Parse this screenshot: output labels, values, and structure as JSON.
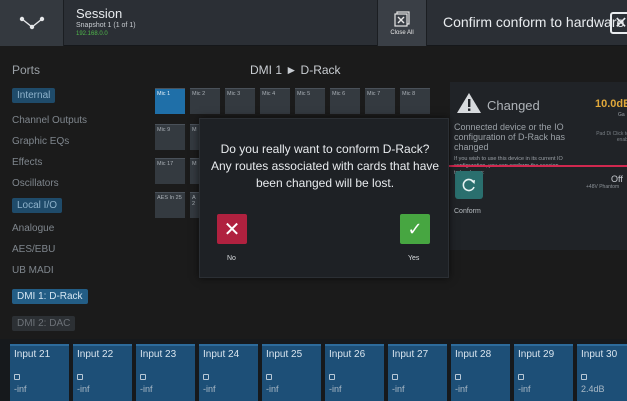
{
  "header": {
    "session_title": "Session",
    "snapshot": "Snapshot 1 (1 of 1)",
    "session_sub": "192.168.0.0",
    "close_all": "Close All",
    "confirm_title": "Confirm conform to hardware"
  },
  "ports": {
    "title": "Ports",
    "items": [
      {
        "label": "Internal",
        "style": "pill-blue"
      },
      {
        "label": "Channel Outputs",
        "style": "plain"
      },
      {
        "label": "Graphic EQs",
        "style": "plain"
      },
      {
        "label": "Effects",
        "style": "plain"
      },
      {
        "label": "Oscillators",
        "style": "plain"
      },
      {
        "label": "Local I/O",
        "style": "pill-blue"
      },
      {
        "label": "Analogue",
        "style": "plain"
      },
      {
        "label": "AES/EBU",
        "style": "plain"
      },
      {
        "label": "UB MADI",
        "style": "plain"
      },
      {
        "label": "DMI 1: D-Rack",
        "style": "pill-blue-bright"
      },
      {
        "label": "DMI 2: DAC",
        "style": "pill-dim"
      }
    ]
  },
  "center": {
    "title": "DMI 1 ► D-Rack",
    "chips_row1": [
      "Mic 1",
      "Mic 2",
      "Mic 3",
      "Mic 4",
      "Mic 5",
      "Mic 6",
      "Mic 7",
      "Mic 8"
    ],
    "chips_left": [
      "Mic 9",
      "Mic 17",
      "AES In 25"
    ],
    "chips_left2": [
      "M",
      "M",
      "A 2"
    ]
  },
  "right_panel": {
    "changed": "Changed",
    "gain": "10.0dB",
    "gain_label": "Ga",
    "description": "Connected device or the IO configuration of D-Rack has changed",
    "hint": "If you wish to use this device in its current IO configuration, you can conform the session to hardware:",
    "pad_label": "Pad Di Click to enabl",
    "phantom_value": "Off",
    "phantom_label": "+48V Phantom",
    "conform_label": "Conform"
  },
  "modal": {
    "message_line1": "Do you really want to conform D-Rack?",
    "message_line2": "Any routes associated with cards that have",
    "message_line3": "been changed will be lost.",
    "no_label": "No",
    "yes_label": "Yes"
  },
  "inputs": [
    {
      "name": "Input 21",
      "level": "-inf"
    },
    {
      "name": "Input 22",
      "level": "-inf"
    },
    {
      "name": "Input 23",
      "level": "-inf"
    },
    {
      "name": "Input 24",
      "level": "-inf"
    },
    {
      "name": "Input 25",
      "level": "-inf"
    },
    {
      "name": "Input 26",
      "level": "-inf"
    },
    {
      "name": "Input 27",
      "level": "-inf"
    },
    {
      "name": "Input 28",
      "level": "-inf"
    },
    {
      "name": "Input 29",
      "level": "-inf"
    },
    {
      "name": "Input 30",
      "level": "2.4dB"
    }
  ],
  "colors": {
    "accent_red": "#d0284f",
    "yes_green": "#47a641",
    "no_red": "#b0213f",
    "gain_orange": "#e0a83a"
  }
}
